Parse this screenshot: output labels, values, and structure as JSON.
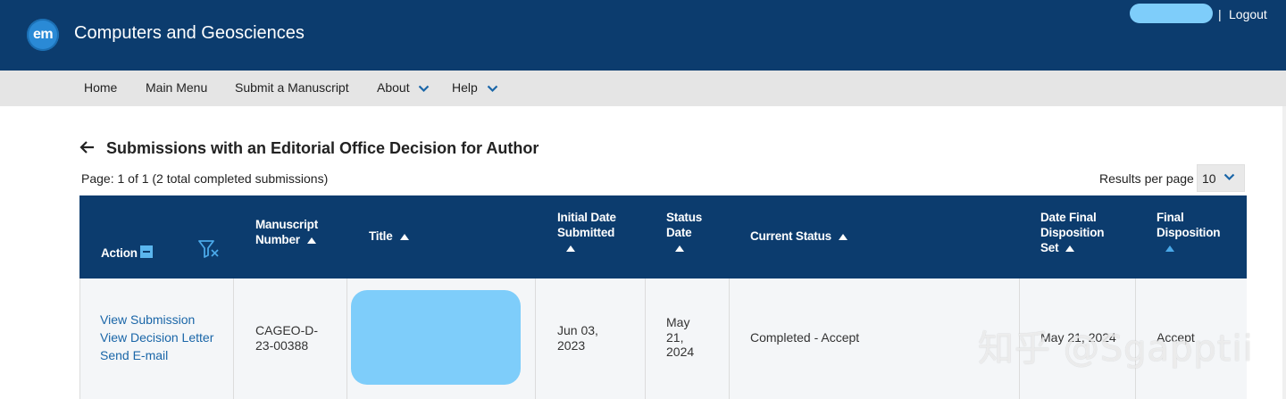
{
  "header": {
    "logo_text": "em",
    "journal_title": "Computers and Geosciences",
    "separator": "|",
    "logout_label": "Logout"
  },
  "nav": {
    "home": "Home",
    "main_menu": "Main Menu",
    "submit": "Submit a Manuscript",
    "about": "About",
    "help": "Help"
  },
  "page": {
    "heading": "Submissions with an Editorial Office Decision for Author",
    "page_info": "Page: 1 of 1 (2 total completed submissions)",
    "results_per_page_label": "Results per page",
    "results_per_page_value": "10"
  },
  "table": {
    "headers": {
      "action": "Action",
      "manuscript_number": [
        "Manuscript",
        "Number"
      ],
      "title": "Title",
      "initial_date": [
        "Initial Date",
        "Submitted"
      ],
      "status_date": [
        "Status",
        "Date"
      ],
      "current_status": "Current Status",
      "date_final": [
        "Date Final",
        "Disposition",
        "Set"
      ],
      "final_disposition": [
        "Final",
        "Disposition"
      ]
    },
    "rows": [
      {
        "actions": [
          "View Submission",
          "View Decision Letter",
          "Send E-mail"
        ],
        "manuscript_number": [
          "CAGEO-D-",
          "23-00388"
        ],
        "initial_date": [
          "Jun 03,",
          "2023"
        ],
        "status_date": [
          "May",
          "21,",
          "2024"
        ],
        "current_status": "Completed - Accept",
        "date_final": "May 21, 2024",
        "final_disposition": "Accept"
      }
    ]
  },
  "watermark": "知乎 @Sgapptii",
  "colors": {
    "header_bg": "#0c3c6e",
    "link": "#1a66a8",
    "accent": "#5bb6ee"
  }
}
